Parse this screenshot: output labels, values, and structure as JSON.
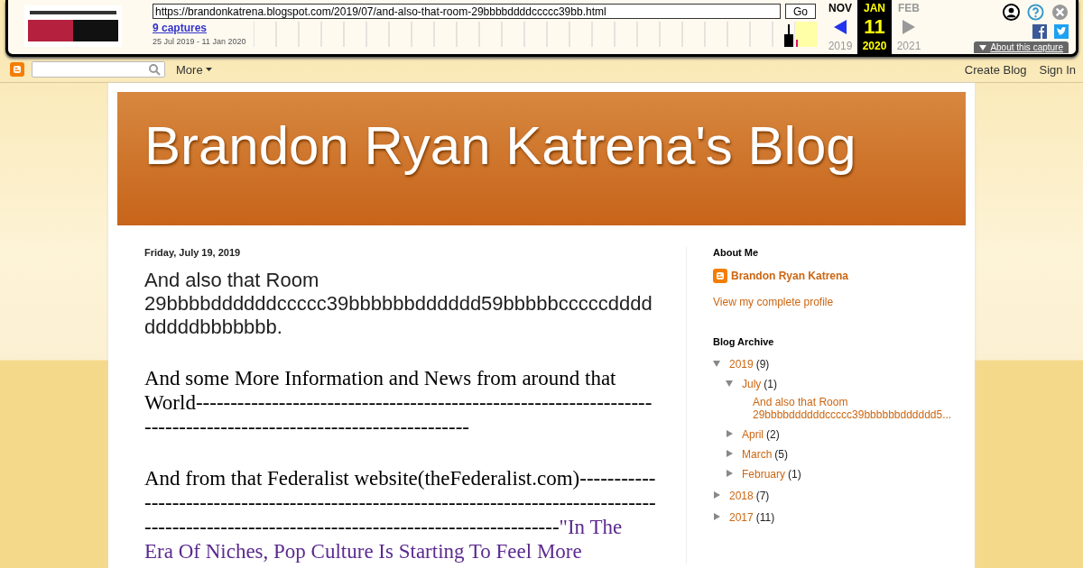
{
  "wayback": {
    "url": "https://brandonkatrena.blogspot.com/2019/07/and-also-that-room-29bbbbddddccccc39bb.html",
    "go": "Go",
    "captures": "9 captures",
    "range": "25 Jul 2019 - 11 Jan 2020",
    "months": [
      {
        "month": "NOV",
        "year": "2019",
        "selected": false,
        "kind": "prev"
      },
      {
        "month": "JAN",
        "day": "11",
        "year": "2020",
        "selected": true,
        "kind": "current"
      },
      {
        "month": "FEB",
        "year": "2021",
        "selected": false,
        "kind": "next"
      }
    ],
    "about": "About this capture"
  },
  "navbar": {
    "more": "More",
    "links": [
      "Create Blog",
      "Sign In"
    ]
  },
  "blog": {
    "title": "Brandon Ryan Katrena's Blog"
  },
  "post": {
    "date": "Friday, July 19, 2019",
    "title": "And also that Room 29bbbbddddddccccc39bbbbbbdddddd59bbbbbcccccdddddddddbbbbbbb.",
    "paragraphs": [
      {
        "kind": "text",
        "text": "And some More Information and News from around that World-----------------------------------------------------------------------------------------------------------------"
      },
      {
        "kind": "text",
        "text": "And from that Federalist website(theFederalist.com)-------------------------------------------------------------------------------------------------------------------------------------------------",
        "link_lines": [
          "\"In The",
          "Era Of Niches, Pop Culture Is Starting To Feel More"
        ]
      }
    ]
  },
  "sidebar": {
    "about_heading": "About Me",
    "profile_name": "Brandon Ryan Katrena",
    "profile_link": "View my complete profile",
    "archive_heading": "Blog Archive",
    "archive": [
      {
        "label": "2019",
        "count": "(9)",
        "expanded": true,
        "children": [
          {
            "label": "July",
            "count": "(1)",
            "expanded": true,
            "posts": [
              "And also that Room 29bbbbddddddccccc39bbbbbbdddddd5..."
            ]
          },
          {
            "label": "April",
            "count": "(2)",
            "expanded": false
          },
          {
            "label": "March",
            "count": "(5)",
            "expanded": false
          },
          {
            "label": "February",
            "count": "(1)",
            "expanded": false
          }
        ]
      },
      {
        "label": "2018",
        "count": "(7)",
        "expanded": false
      },
      {
        "label": "2017",
        "count": "(11)",
        "expanded": false
      }
    ]
  }
}
